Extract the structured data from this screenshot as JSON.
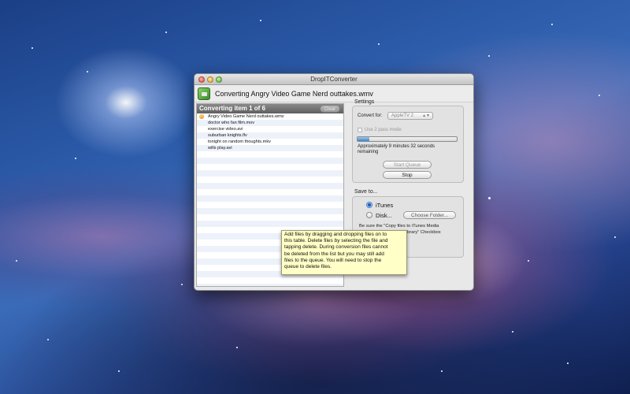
{
  "window": {
    "title": "DropITConverter",
    "header_title": "Converting Angry Video Game Nerd outtakes.wmv"
  },
  "queue": {
    "header": "Converting item 1 of 6",
    "clear_label": "Clear",
    "items": [
      "Angry Video Game Nerd outtakes.wmv",
      "doctor who fan film.mov",
      "exercise video.avi",
      "suburban knights.flv",
      "tonight on random thoughts.mkv",
      "wills play.avi"
    ]
  },
  "settings": {
    "label": "Settings",
    "convert_for_label": "Convert for:",
    "convert_for_value": "AppleTV 2",
    "two_pass_label": "Use 2 pass mode",
    "progress": 0.12,
    "eta_line1": "Approximately 9 minutes 32 seconds",
    "eta_line2": "remaining",
    "start_queue_label": "Start Queue",
    "stop_label": "Stop"
  },
  "save_to": {
    "label": "Save to...",
    "itunes_label": "iTunes",
    "disk_label": "Disk...",
    "choose_folder_label": "Choose Folder...",
    "note_line1": "Be sure the \"Copy files to iTunes Media",
    "note_line2": "to library\" Checkbox"
  },
  "tooltip": {
    "line1": "Add files by dragging and dropping files on to",
    "line2": "this table.  Delete files by selecting the file and",
    "line3": "tapping delete.  During conversion files cannot",
    "line4": "be deleted from the list but you may still add",
    "line5": "files to the queue. You will need to stop the",
    "line6": "queue to delete files."
  }
}
